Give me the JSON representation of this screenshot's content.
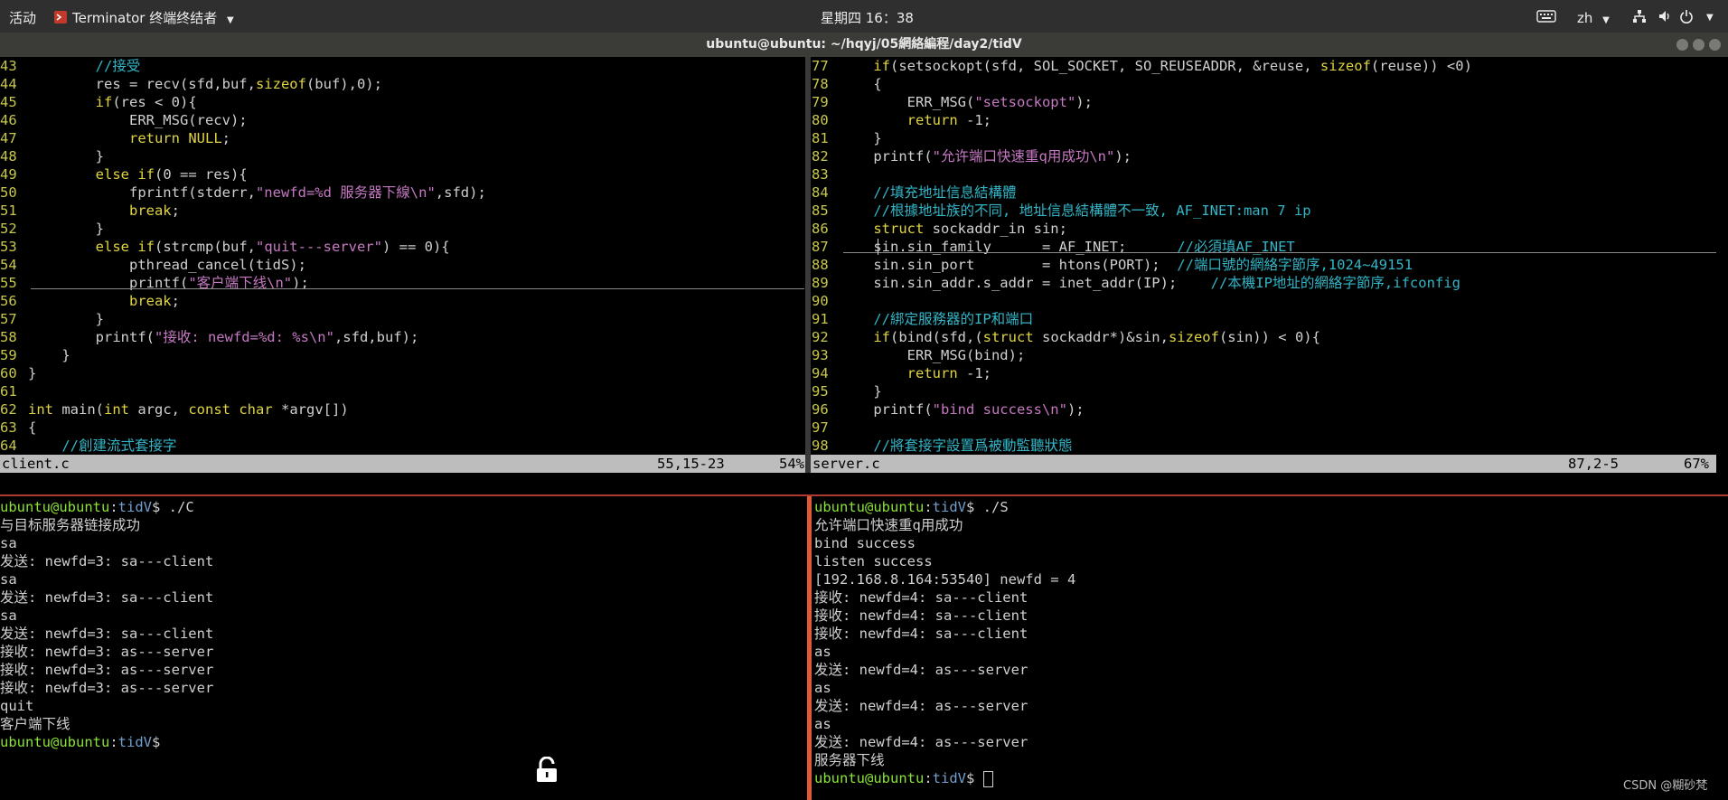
{
  "topbar": {
    "activities": "活动",
    "app_name": "Terminator 终端终结者",
    "clock": "星期四 16：38",
    "input_method": "zh"
  },
  "window": {
    "title": "ubuntu@ubuntu: ~/hqyj/05網絡編程/day2/tidV"
  },
  "left_editor": {
    "lines": [
      {
        "n": "43",
        "t": "        //接受"
      },
      {
        "n": "44",
        "t": "        res = recv(sfd,buf,sizeof(buf),0);"
      },
      {
        "n": "45",
        "t": "        if(res < 0){"
      },
      {
        "n": "46",
        "t": "            ERR_MSG(recv);"
      },
      {
        "n": "47",
        "t": "            return NULL;"
      },
      {
        "n": "48",
        "t": "        }"
      },
      {
        "n": "49",
        "t": "        else if(0 == res){"
      },
      {
        "n": "50",
        "t": "            fprintf(stderr,\"newfd=%d 服务器下線\\n\",sfd);"
      },
      {
        "n": "51",
        "t": "            break;"
      },
      {
        "n": "52",
        "t": "        }"
      },
      {
        "n": "53",
        "t": "        else if(strcmp(buf,\"quit---server\") == 0){"
      },
      {
        "n": "54",
        "t": "            pthread_cancel(tidS);"
      },
      {
        "n": "55",
        "t": "            printf(\"客户端下线\\n\");"
      },
      {
        "n": "56",
        "t": "            break;"
      },
      {
        "n": "57",
        "t": "        }"
      },
      {
        "n": "58",
        "t": "        printf(\"接收: newfd=%d: %s\\n\",sfd,buf);"
      },
      {
        "n": "59",
        "t": "    }"
      },
      {
        "n": "60",
        "t": "}"
      },
      {
        "n": "61",
        "t": ""
      },
      {
        "n": "62",
        "t": "int main(int argc, const char *argv[])"
      },
      {
        "n": "63",
        "t": "{"
      },
      {
        "n": "64",
        "t": "    //創建流式套接字"
      }
    ],
    "status_file": "client.c",
    "status_pos": "55,15-23",
    "status_pct": "54%"
  },
  "right_editor": {
    "lines": [
      {
        "n": "77",
        "t": "    if(setsockopt(sfd, SOL_SOCKET, SO_REUSEADDR, &reuse, sizeof(reuse)) <0)"
      },
      {
        "n": "78",
        "t": "    {"
      },
      {
        "n": "79",
        "t": "        ERR_MSG(\"setsockopt\");"
      },
      {
        "n": "80",
        "t": "        return -1;"
      },
      {
        "n": "81",
        "t": "    }"
      },
      {
        "n": "82",
        "t": "    printf(\"允许端口快速重q用成功\\n\");"
      },
      {
        "n": "83",
        "t": ""
      },
      {
        "n": "84",
        "t": "    //填充地址信息結構體"
      },
      {
        "n": "85",
        "t": "    //根據地址族的不同, 地址信息結構體不一致, AF_INET:man 7 ip"
      },
      {
        "n": "86",
        "t": "    struct sockaddr_in sin;"
      },
      {
        "n": "87",
        "t": "    sin.sin_family      = AF_INET;      //必須填AF_INET"
      },
      {
        "n": "88",
        "t": "    sin.sin_port        = htons(PORT);  //端口號的網絡字節序,1024~49151"
      },
      {
        "n": "89",
        "t": "    sin.sin_addr.s_addr = inet_addr(IP);    //本機IP地址的網絡字節序,ifconfig"
      },
      {
        "n": "90",
        "t": ""
      },
      {
        "n": "91",
        "t": "    //綁定服務器的IP和端口"
      },
      {
        "n": "92",
        "t": "    if(bind(sfd,(struct sockaddr*)&sin,sizeof(sin)) < 0){"
      },
      {
        "n": "93",
        "t": "        ERR_MSG(bind);"
      },
      {
        "n": "94",
        "t": "        return -1;"
      },
      {
        "n": "95",
        "t": "    }"
      },
      {
        "n": "96",
        "t": "    printf(\"bind success\\n\");"
      },
      {
        "n": "97",
        "t": ""
      },
      {
        "n": "98",
        "t": "    //將套接字設置爲被動監聽狀態"
      }
    ],
    "status_file": "server.c",
    "status_pos": "87,2-5",
    "status_pct": "67%"
  },
  "prompt": {
    "user": "ubuntu@ubuntu",
    "path": "tidV",
    "symbol": "$"
  },
  "left_terminal": {
    "command": " ./C",
    "output": [
      "与目标服务器链接成功",
      "sa",
      "发送: newfd=3: sa---client",
      "sa",
      "发送: newfd=3: sa---client",
      "sa",
      "发送: newfd=3: sa---client",
      "接收: newfd=3: as---server",
      "接收: newfd=3: as---server",
      "接收: newfd=3: as---server",
      "quit",
      "客户端下线"
    ]
  },
  "right_terminal": {
    "command": " ./S",
    "output": [
      "允许端口快速重q用成功",
      "bind success",
      "listen success",
      "[192.168.8.164:53540] newfd = 4",
      "接收: newfd=4: sa---client",
      "接收: newfd=4: sa---client",
      "接收: newfd=4: sa---client",
      "as",
      "发送: newfd=4: as---server",
      "as",
      "发送: newfd=4: as---server",
      "as",
      "发送: newfd=4: as---server",
      "服务器下线"
    ]
  },
  "watermark": "CSDN @糊砂梵",
  "colors": {
    "topbar": "#2f2f2f",
    "titlebar": "#3b3b38",
    "line_number": "#c8c84c",
    "comment": "#32b6c7",
    "keyword": "#e0d540",
    "string": "#c678c2",
    "prompt_user": "#8ae234",
    "prompt_path": "#729fcf",
    "pane_divider": "#b03a30"
  }
}
